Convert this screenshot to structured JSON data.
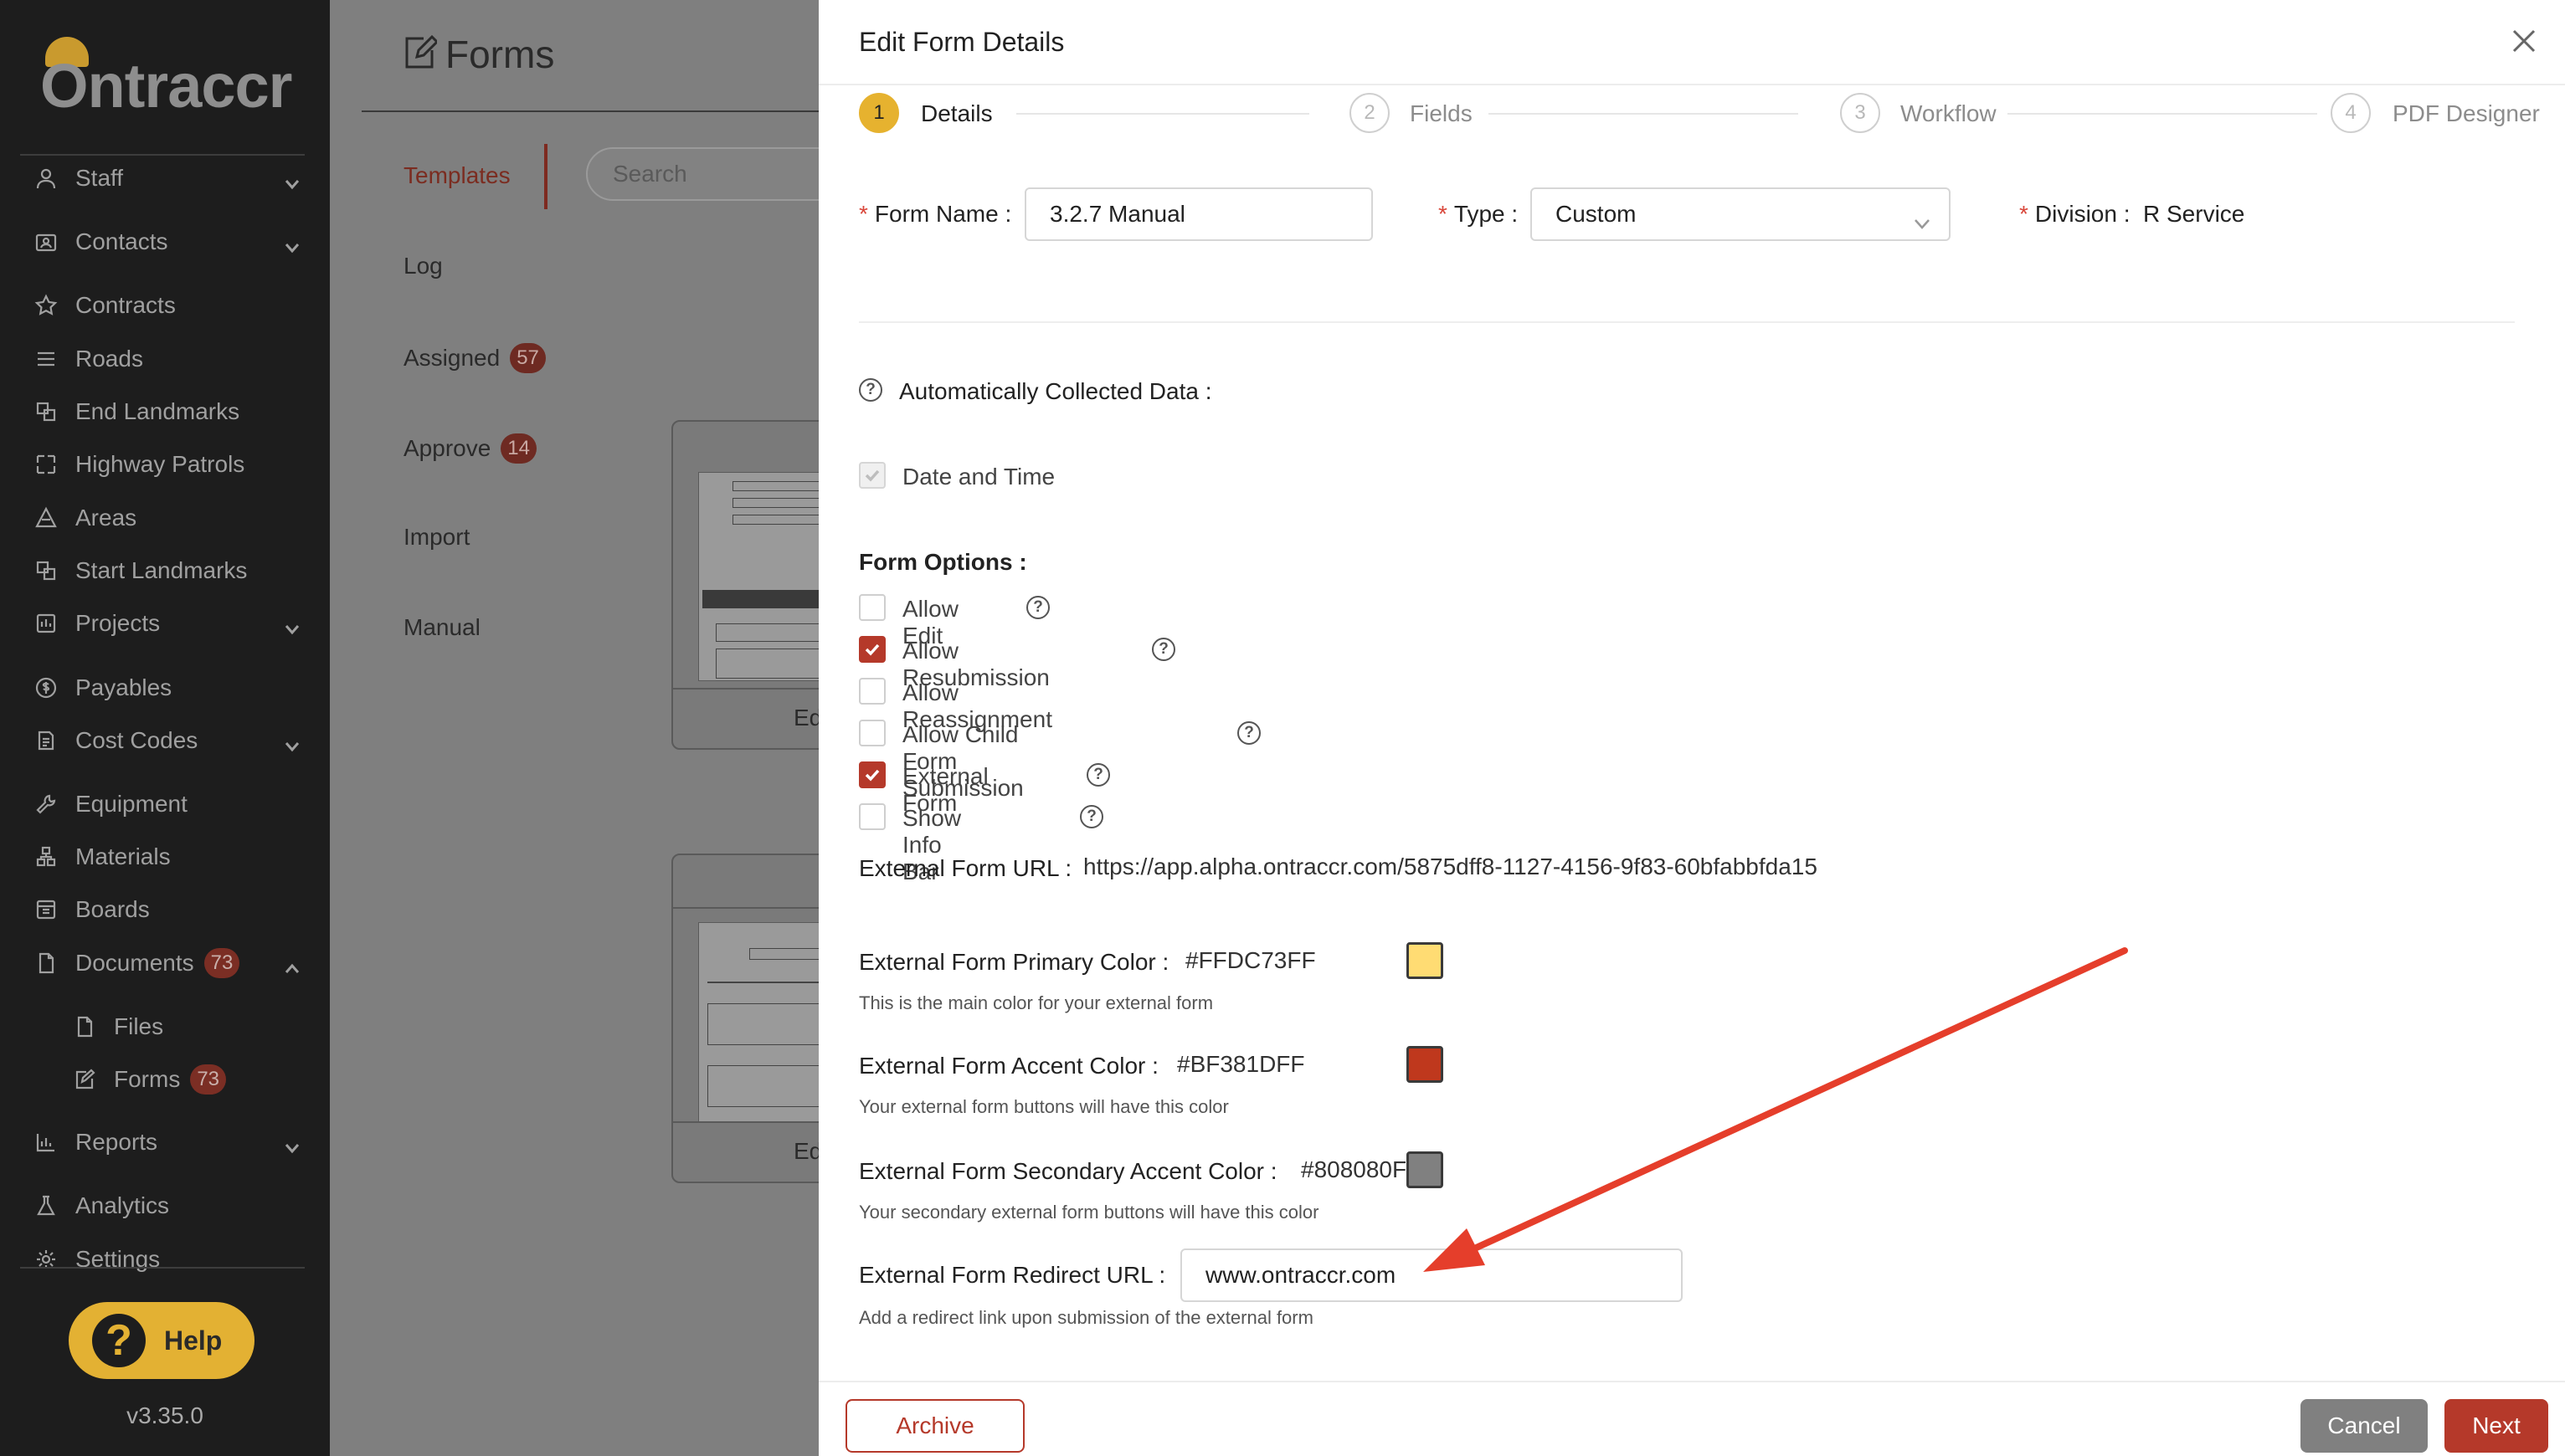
{
  "sidebar": {
    "logo": "Ontraccr",
    "items": [
      {
        "label": "Staff",
        "icon": "user-icon",
        "chevron": true,
        "badge": ""
      },
      {
        "label": "Contacts",
        "icon": "contacts-icon",
        "chevron": true,
        "badge": ""
      },
      {
        "label": "Contracts",
        "icon": "star-icon",
        "chevron": false,
        "badge": ""
      },
      {
        "label": "Roads",
        "icon": "roads-icon",
        "chevron": false,
        "badge": ""
      },
      {
        "label": "End Landmarks",
        "icon": "landmark-icon",
        "chevron": false,
        "badge": ""
      },
      {
        "label": "Highway Patrols",
        "icon": "patrol-icon",
        "chevron": false,
        "badge": ""
      },
      {
        "label": "Areas",
        "icon": "areas-icon",
        "chevron": false,
        "badge": ""
      },
      {
        "label": "Start Landmarks",
        "icon": "landmark-icon",
        "chevron": false,
        "badge": ""
      },
      {
        "label": "Projects",
        "icon": "projects-icon",
        "chevron": true,
        "badge": ""
      },
      {
        "label": "Payables",
        "icon": "dollar-icon",
        "chevron": false,
        "badge": ""
      },
      {
        "label": "Cost Codes",
        "icon": "cost-codes-icon",
        "chevron": true,
        "badge": ""
      },
      {
        "label": "Equipment",
        "icon": "wrench-icon",
        "chevron": false,
        "badge": ""
      },
      {
        "label": "Materials",
        "icon": "materials-icon",
        "chevron": false,
        "badge": ""
      },
      {
        "label": "Boards",
        "icon": "boards-icon",
        "chevron": false,
        "badge": ""
      },
      {
        "label": "Documents",
        "icon": "document-icon",
        "chevron": true,
        "badge": "73"
      },
      {
        "label": "Files",
        "icon": "file-icon",
        "chevron": false,
        "badge": ""
      },
      {
        "label": "Forms",
        "icon": "form-edit-icon",
        "chevron": false,
        "badge": "73"
      },
      {
        "label": "Reports",
        "icon": "reports-icon",
        "chevron": true,
        "badge": ""
      },
      {
        "label": "Analytics",
        "icon": "analytics-icon",
        "chevron": false,
        "badge": ""
      },
      {
        "label": "Settings",
        "icon": "settings-icon",
        "chevron": false,
        "badge": ""
      }
    ],
    "help_label": "Help",
    "version": "v3.35.0"
  },
  "page": {
    "title": "Forms",
    "search_placeholder": "Search",
    "tabs": [
      {
        "label": "Templates",
        "badge": ""
      },
      {
        "label": "Log",
        "badge": ""
      },
      {
        "label": "Assigned",
        "badge": "57"
      },
      {
        "label": "Approve",
        "badge": "14"
      },
      {
        "label": "Import",
        "badge": ""
      },
      {
        "label": "Manual",
        "badge": ""
      }
    ],
    "card_action_1": "Ed",
    "card_action_2": "Ed"
  },
  "modal": {
    "title": "Edit Form Details",
    "steps": [
      {
        "num": "1",
        "label": "Details"
      },
      {
        "num": "2",
        "label": "Fields"
      },
      {
        "num": "3",
        "label": "Workflow"
      },
      {
        "num": "4",
        "label": "PDF Designer"
      }
    ],
    "form_name_label": "Form Name",
    "form_name_value": "3.2.7 Manual",
    "type_label": "Type",
    "type_value": "Custom",
    "division_label": "Division",
    "division_value": "R Service",
    "auto_collected_label": "Automatically Collected Data",
    "date_time_label": "Date and Time",
    "form_options_label": "Form Options",
    "options": [
      {
        "label": "Allow Edit",
        "checked": false,
        "help": true
      },
      {
        "label": "Allow Resubmission",
        "checked": true,
        "help": true
      },
      {
        "label": "Allow Reassignment",
        "checked": false,
        "help": false
      },
      {
        "label": "Allow Child Form Submission",
        "checked": false,
        "help": true
      },
      {
        "label": "External Form",
        "checked": true,
        "help": true
      },
      {
        "label": "Show Info Bar",
        "checked": false,
        "help": true
      }
    ],
    "external_url_label": "External Form URL",
    "external_url_value": "https://app.alpha.ontraccr.com/5875dff8-1127-4156-9f83-60bfabbfda15",
    "primary_color_label": "External Form Primary Color",
    "primary_color_value": "#FFDC73FF",
    "primary_color_hint": "This is the main color for your external form",
    "accent_color_label": "External Form Accent Color",
    "accent_color_value": "#BF381DFF",
    "accent_color_hint": "Your external form buttons will have this color",
    "secondary_color_label": "External Form Secondary Accent Color",
    "secondary_color_value": "#808080FF",
    "secondary_color_hint": "Your secondary external form buttons will have this color",
    "redirect_label": "External Form Redirect URL",
    "redirect_value": "www.ontraccr.com",
    "redirect_hint": "Add a redirect link upon submission of the external form",
    "archive_label": "Archive",
    "cancel_label": "Cancel",
    "next_label": "Next"
  },
  "colors": {
    "primary_swatch": "#FFDC73",
    "accent_swatch": "#BF381D",
    "secondary_swatch": "#808080",
    "brand_red": "#B5392A",
    "step_active": "#E6B22F",
    "annotation_arrow": "#E53E2B"
  }
}
